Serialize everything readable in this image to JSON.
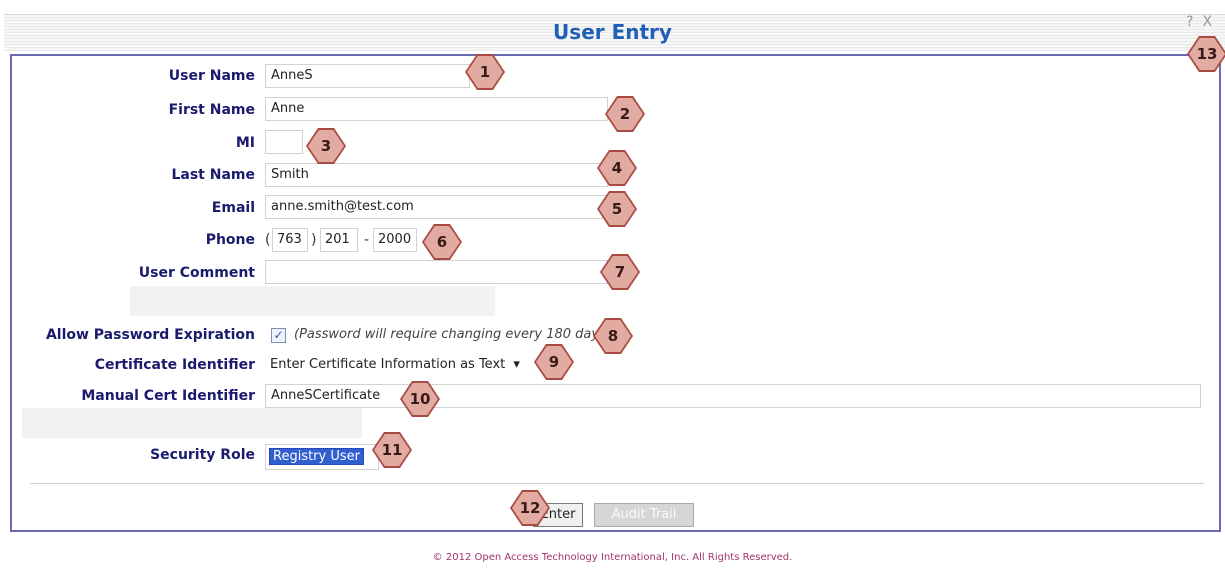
{
  "window": {
    "title": "User Entry",
    "help": "?",
    "close": "X"
  },
  "form": {
    "user_name": {
      "label": "User Name",
      "value": "AnneS"
    },
    "first_name": {
      "label": "First Name",
      "value": "Anne"
    },
    "mi": {
      "label": "MI",
      "value": ""
    },
    "last_name": {
      "label": "Last Name",
      "value": "Smith"
    },
    "email": {
      "label": "Email",
      "value": "anne.smith@test.com"
    },
    "phone": {
      "label": "Phone",
      "open_paren": "(",
      "area": "763",
      "close_paren": ")",
      "prefix": "201",
      "dash": "-",
      "line": "2000"
    },
    "user_comment": {
      "label": "User Comment",
      "value": ""
    },
    "allow_password_expiration": {
      "label": "Allow Password Expiration",
      "checked": true,
      "check_glyph": "✓",
      "note": "(Password will require changing every 180 days)"
    },
    "certificate_identifier": {
      "label": "Certificate Identifier",
      "value": "Enter Certificate Information as Text",
      "arrow": "▾"
    },
    "manual_cert_identifier": {
      "label": "Manual Cert Identifier",
      "value": "AnneSCertificate"
    },
    "security_role": {
      "label": "Security Role",
      "value": "Registry User"
    }
  },
  "buttons": {
    "enter": "Enter",
    "audit_trail": "Audit Trail"
  },
  "callouts": [
    "1",
    "2",
    "3",
    "4",
    "5",
    "6",
    "7",
    "8",
    "9",
    "10",
    "11",
    "12",
    "13"
  ],
  "footer": "© 2012 Open Access Technology International, Inc. All Rights Reserved.",
  "colors": {
    "title": "#1f5fb8",
    "label": "#1a1a6e",
    "panel_border": "#6a6ab0",
    "callout_fill": "#e1aba1",
    "callout_border": "#a84a42",
    "footer": "#a0346a"
  }
}
